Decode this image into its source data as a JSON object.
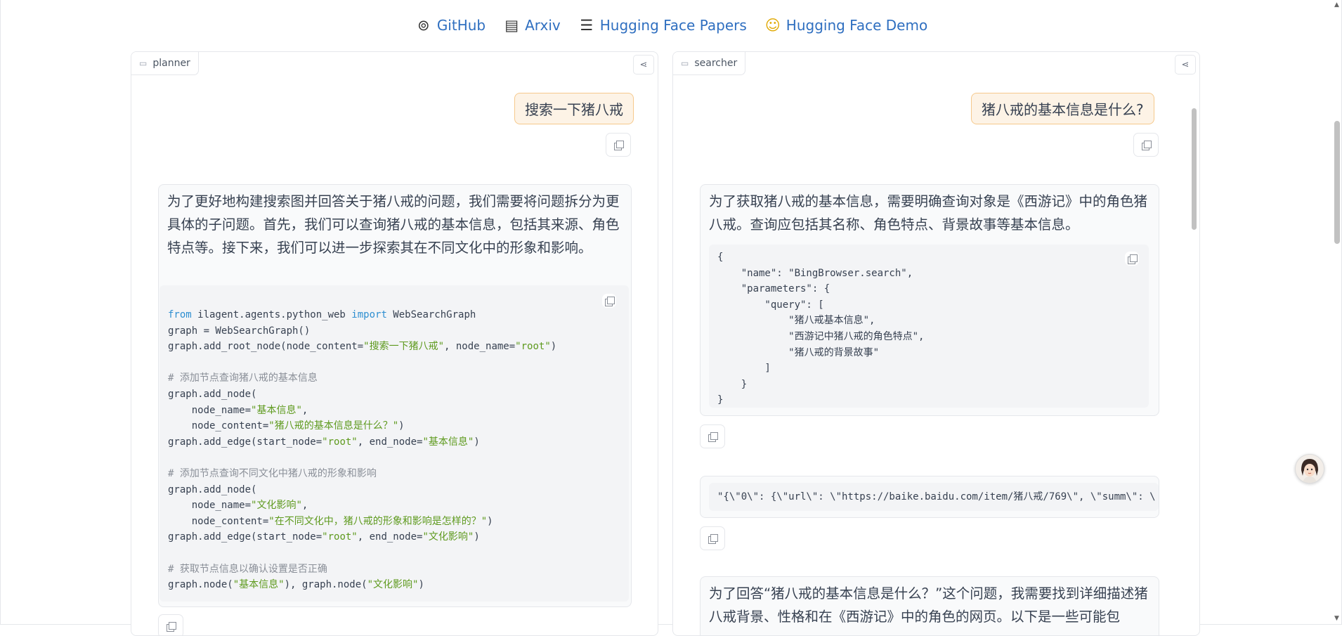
{
  "links": [
    {
      "icon": "github-icon",
      "glyph": "⊚",
      "label": "GitHub"
    },
    {
      "icon": "document-icon",
      "glyph": "▤",
      "label": "Arxiv"
    },
    {
      "icon": "books-icon",
      "glyph": "☰",
      "label": "Hugging Face Papers"
    },
    {
      "icon": "hugging-face-icon",
      "glyph": "☺",
      "label": "Hugging Face Demo"
    }
  ],
  "planner": {
    "tab_label": "planner",
    "user_message": "搜索一下猪八戒",
    "assistant_text": "为了更好地构建搜索图并回答关于猪八戒的问题，我们需要将问题拆分为更具体的子问题。首先，我们可以查询猪八戒的基本信息，包括其来源、角色特点等。接下来，我们可以进一步探索其在不同文化中的形象和影响。",
    "code": {
      "l1_kw1": "from",
      "l1_mod": " ilagent.agents.python_web ",
      "l1_kw2": "import",
      "l1_rest": " WebSearchGraph",
      "l2": "graph = WebSearchGraph()",
      "l3_a": "graph.add_root_node(node_content=",
      "l3_s1": "\"搜索一下猪八戒\"",
      "l3_b": ", node_name=",
      "l3_s2": "\"root\"",
      "l3_c": ")",
      "c1": "# 添加节点查询猪八戒的基本信息",
      "l5": "graph.add_node(",
      "l6_a": "    node_name=",
      "l6_s": "\"基本信息\"",
      "l6_b": ",",
      "l7_a": "    node_content=",
      "l7_s": "\"猪八戒的基本信息是什么？\"",
      "l7_b": ")",
      "l8_a": "graph.add_edge(start_node=",
      "l8_s1": "\"root\"",
      "l8_b": ", end_node=",
      "l8_s2": "\"基本信息\"",
      "l8_c": ")",
      "c2": "# 添加节点查询不同文化中猪八戒的形象和影响",
      "l10": "graph.add_node(",
      "l11_a": "    node_name=",
      "l11_s": "\"文化影响\"",
      "l11_b": ",",
      "l12_a": "    node_content=",
      "l12_s": "\"在不同文化中，猪八戒的形象和影响是怎样的？\"",
      "l12_b": ")",
      "l13_a": "graph.add_edge(start_node=",
      "l13_s1": "\"root\"",
      "l13_b": ", end_node=",
      "l13_s2": "\"文化影响\"",
      "l13_c": ")",
      "c3": "# 获取节点信息以确认设置是否正确",
      "l15_a": "graph.node(",
      "l15_s1": "\"基本信息\"",
      "l15_b": "), graph.node(",
      "l15_s2": "\"文化影响\"",
      "l15_c": ")"
    }
  },
  "searcher": {
    "tab_label": "searcher",
    "user_message": "猪八戒的基本信息是什么?",
    "assistant_text": "为了获取猪八戒的基本信息，需要明确查询对象是《西游记》中的角色猪八戒。查询应包括其名称、角色特点、背景故事等基本信息。",
    "json_code": "{\n    \"name\": \"BingBrowser.search\",\n    \"parameters\": {\n        \"query\": [\n            \"猪八戒基本信息\",\n            \"西游记中猪八戒的角色特点\",\n            \"猪八戒的背景故事\"\n        ]\n    }\n}",
    "tool_result": "\"{\\\"0\\\": {\\\"url\\\": \\\"https://baike.baidu.com/item/猪八戒/769\\\", \\\"summ\\\": \\",
    "final_text": "为了回答“猪八戒的基本信息是什么？”这个问题，我需要找到详细描述猪八戒背景、性格和在《西游记》中的角色的网页。以下是一些可能包"
  }
}
